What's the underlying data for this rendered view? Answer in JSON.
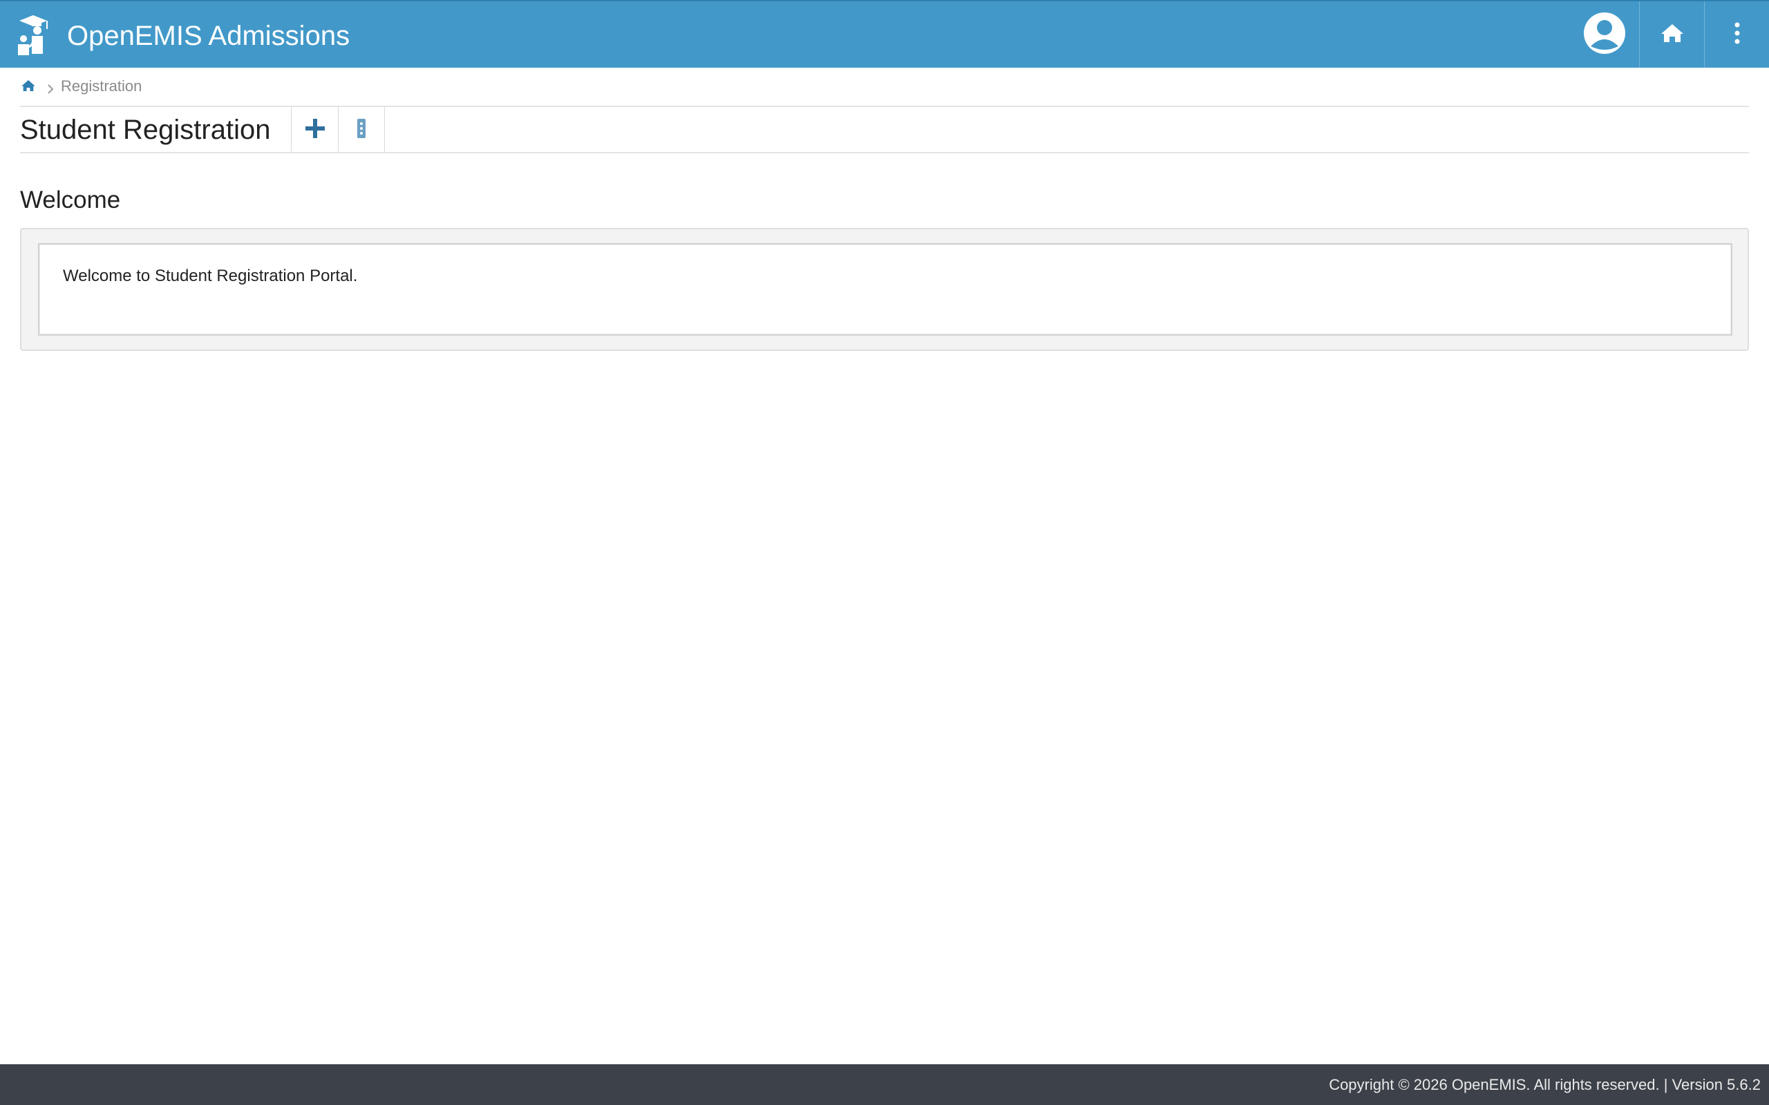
{
  "header": {
    "app_title": "OpenEMIS Admissions",
    "logo_icon": "openemis-logo-icon",
    "user_icon": "user-avatar-icon",
    "home_icon": "home-icon",
    "menu_icon": "vertical-dots-icon",
    "background_color": "#4299c9"
  },
  "breadcrumb": {
    "home_icon": "home-icon",
    "separator_icon": "chevron-right-icon",
    "current": "Registration"
  },
  "page": {
    "title": "Student Registration",
    "toolbar": {
      "add_icon": "plus-icon",
      "options_icon": "options-icon"
    }
  },
  "welcome": {
    "heading": "Welcome",
    "message": "Welcome to Student Registration Portal."
  },
  "footer": {
    "text": "Copyright © 2026 OpenEMIS. All rights reserved. | Version 5.6.2",
    "background_color": "#3d4149"
  }
}
